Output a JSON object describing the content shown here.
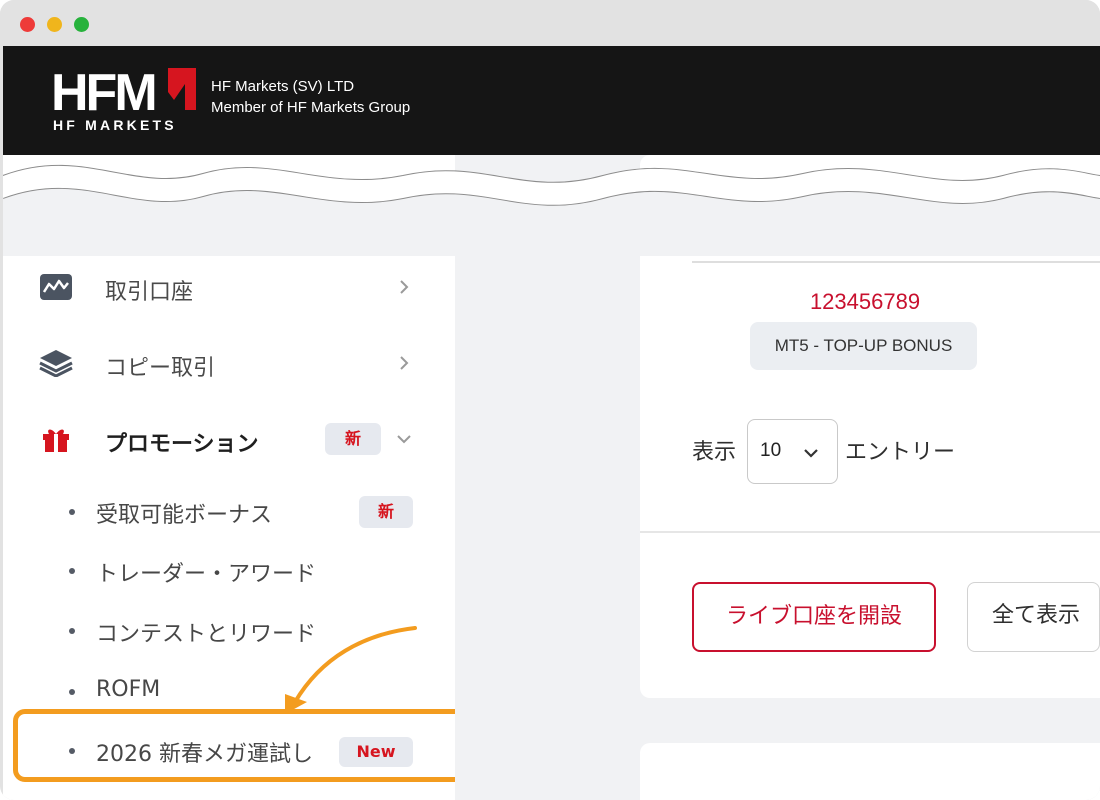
{
  "window": {
    "controls": [
      "close",
      "minimize",
      "maximize"
    ]
  },
  "header": {
    "logo_icon": "hfm-logo-icon",
    "logo_text": "HFM",
    "logo_subtext": "HF MARKETS",
    "company_line1": "HF Markets (SV) LTD",
    "company_line2": "Member of HF Markets Group"
  },
  "sidebar": {
    "items": [
      {
        "label": "取引口座",
        "icon": "chart-icon",
        "chevron": "chevron-right-icon"
      },
      {
        "label": "コピー取引",
        "icon": "layers-icon",
        "chevron": "chevron-right-icon"
      },
      {
        "label": "プロモーション",
        "icon": "gift-icon",
        "badge": "新",
        "chevron": "chevron-down-icon",
        "expanded": true
      }
    ],
    "subitems": [
      {
        "label": "受取可能ボーナス",
        "badge": "新"
      },
      {
        "label": "トレーダー・アワード"
      },
      {
        "label": "コンテストとリワード"
      },
      {
        "label": "ROFM"
      },
      {
        "label": "2026 新春メガ運試し",
        "badge": "New",
        "highlighted": true
      }
    ]
  },
  "main": {
    "sort_icon": "arrow-down-icon",
    "account_number": "123456789",
    "account_type": "MT5 - TOP-UP BONUS",
    "show_label": "表示",
    "page_size": "10",
    "entries_label": "エントリー",
    "open_live_button": "ライブ口座を開設",
    "show_all_button": "全て表示"
  },
  "colors": {
    "brand_red": "#c8102e",
    "header_bg": "#151515",
    "highlight": "#f39c1f",
    "badge_bg": "#e6e9ef"
  }
}
